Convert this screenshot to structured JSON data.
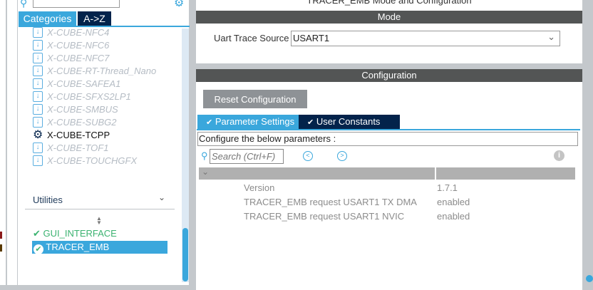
{
  "left": {
    "tabs": [
      {
        "label": "Categories"
      },
      {
        "label": "A->Z"
      }
    ],
    "packs": [
      "X-CUBE-NFC4",
      "X-CUBE-NFC6",
      "X-CUBE-NFC7",
      "X-CUBE-RT-Thread_Nano",
      "X-CUBE-SAFEA1",
      "X-CUBE-SFXS2LP1",
      "X-CUBE-SMBUS",
      "X-CUBE-SUBG2",
      "X-CUBE-TCPP",
      "X-CUBE-TOF1",
      "X-CUBE-TOUCHGFX"
    ],
    "utilities_label": "Utilities",
    "utilities": [
      {
        "label": "GUI_INTERFACE"
      },
      {
        "label": "TRACER_EMB"
      }
    ]
  },
  "right": {
    "title": "TRACER_EMB Mode and Configuration",
    "mode_header": "Mode",
    "uart_label": "Uart Trace Source",
    "uart_value": "USART1",
    "config_header": "Configuration",
    "reset_button": "Reset Configuration",
    "tabs": [
      {
        "label": "Parameter Settings"
      },
      {
        "label": "User Constants"
      }
    ],
    "configure_text": "Configure the below parameters :",
    "search_placeholder": "Search (Ctrl+F)",
    "params": [
      {
        "name": "Version",
        "value": "1.7.1"
      },
      {
        "name": "TRACER_EMB request USART1 TX DMA",
        "value": "enabled"
      },
      {
        "name": "TRACER_EMB request USART1 NVIC",
        "value": "enabled"
      }
    ]
  }
}
